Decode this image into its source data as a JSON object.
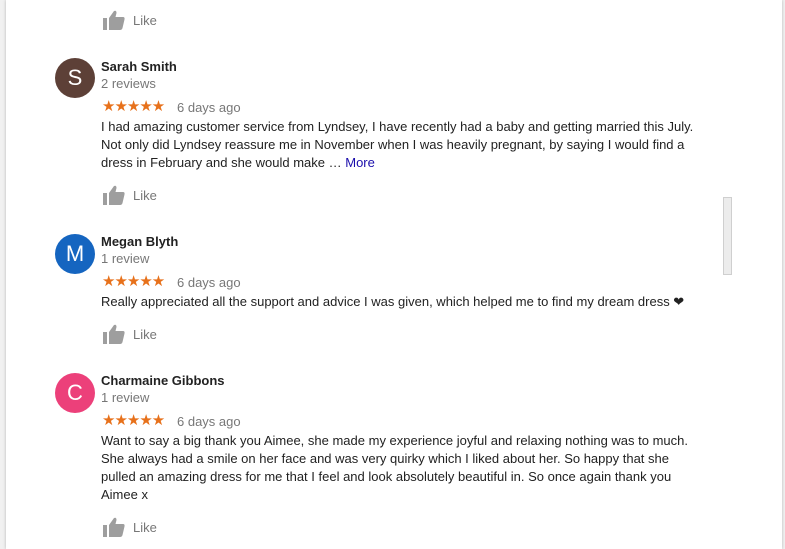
{
  "like_label": "Like",
  "reviews": [
    {
      "initial": "S",
      "avatar_color": "#5d4037",
      "name": "Sarah Smith",
      "review_count": "2 reviews",
      "stars": "★★★★★",
      "date": "6 days ago",
      "text": "I had amazing customer service from Lyndsey, I have recently had a baby and getting married this July. Not only did Lyndsey reassure me in November when I was heavily pregnant, by saying I would find a dress in February and she would make … ",
      "more": "More"
    },
    {
      "initial": "M",
      "avatar_color": "#1565c0",
      "name": "Megan Blyth",
      "review_count": "1 review",
      "stars": "★★★★★",
      "date": "6 days ago",
      "text": "Really appreciated all the support and advice I was given, which helped me to find my dream dress ❤"
    },
    {
      "initial": "C",
      "avatar_color": "#ec407a",
      "name": "Charmaine Gibbons",
      "review_count": "1 review",
      "stars": "★★★★★",
      "date": "6 days ago",
      "text": "Want to say a big thank you Aimee, she made my experience joyful and relaxing nothing was to much. She always had a smile on her face and was very quirky which I liked about her. So happy that she pulled an amazing dress for me that I feel and look absolutely beautiful in. So once again thank you Aimee x"
    }
  ]
}
